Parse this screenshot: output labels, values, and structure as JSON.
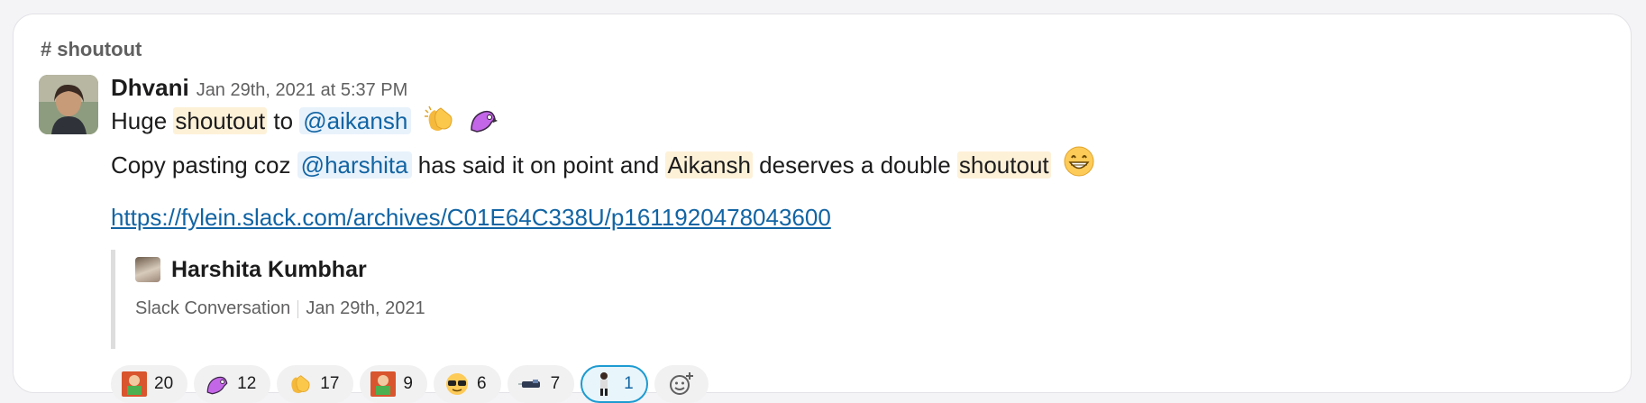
{
  "channel": {
    "hash": "#",
    "name": "shoutout"
  },
  "message": {
    "author": "Dhvani",
    "timestamp": "Jan 29th, 2021 at 5:37 PM",
    "line1": {
      "t1": "Huge ",
      "hl1": "shoutout",
      "t2": " to ",
      "mention": "@aikansh",
      "emojis": [
        "clap-icon",
        "partyparrot-icon"
      ]
    },
    "line2": {
      "t1": "Copy pasting coz ",
      "mention": "@harshita",
      "t2": " has said it on point and ",
      "hl1": "Aikansh",
      "t3": " deserves a double ",
      "hl2": "shoutout",
      "emoji": "grin-icon"
    },
    "link": "https://fylein.slack.com/archives/C01E64C338U/p1611920478043600",
    "attachment": {
      "author": "Harshita Kumbhar",
      "source": "Slack Conversation",
      "date": "Jan 29th, 2021"
    },
    "reactions": [
      {
        "icon": "gift-person-icon",
        "count": "20"
      },
      {
        "icon": "party-parrot-icon",
        "count": "12"
      },
      {
        "icon": "clap-icon",
        "count": "17"
      },
      {
        "icon": "gift-person-icon",
        "count": "9"
      },
      {
        "icon": "sunglasses-face-icon",
        "count": "6"
      },
      {
        "icon": "rocket-car-icon",
        "count": "7"
      },
      {
        "icon": "person-standing-icon",
        "count": "1",
        "active": true
      }
    ]
  },
  "colors": {
    "mention_text": "#1264a3",
    "mention_bg": "#e8f2fb",
    "highlight_bg": "#fdf1d8",
    "active_reaction_border": "#1d9bd1"
  }
}
